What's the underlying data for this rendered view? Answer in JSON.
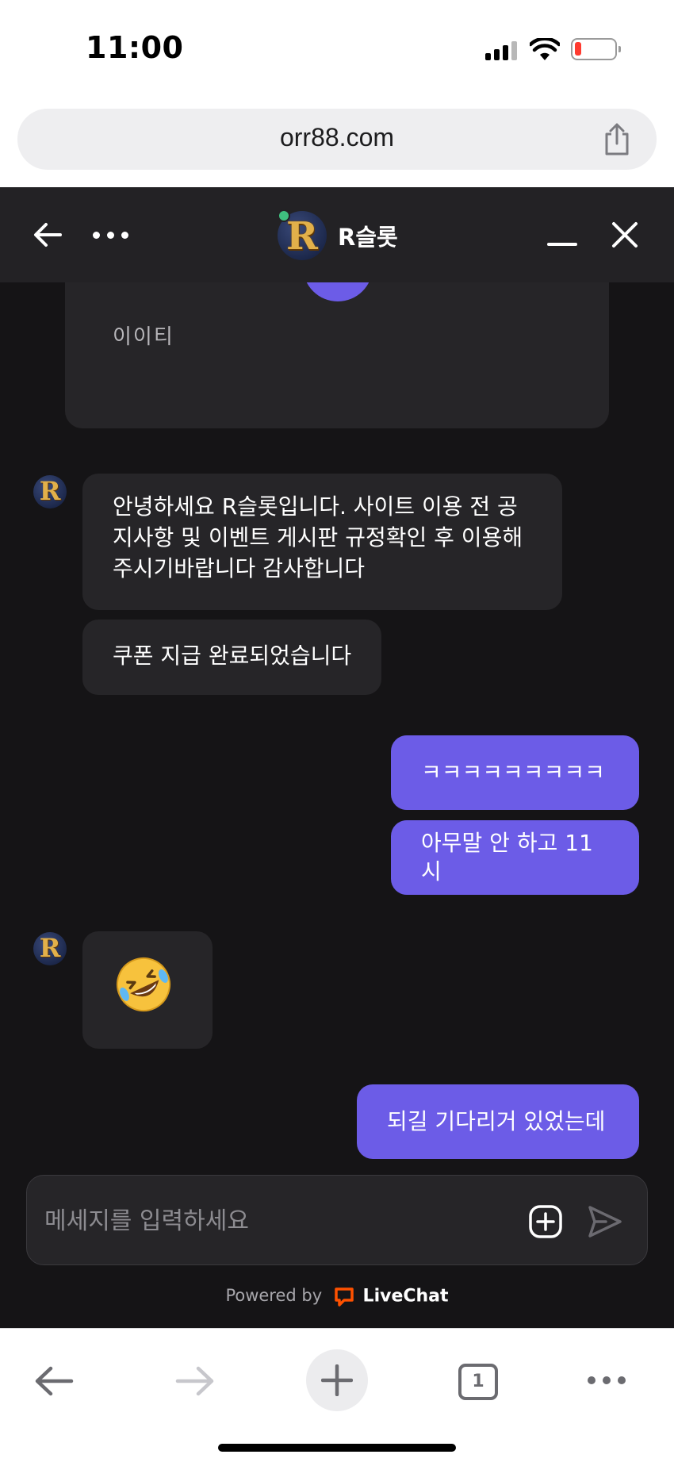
{
  "status_bar": {
    "time": "11:00"
  },
  "browser": {
    "url": "orr88.com",
    "tab_count": "1"
  },
  "chat": {
    "title": "R슬롯",
    "avatar_letter": "R",
    "card_text": "이이티",
    "messages": [
      {
        "from": "agent",
        "text": "안녕하세요 R슬롯입니다. 사이트 이용 전 공지사항 및 이벤트 게시판 규정확인 후 이용해주시기바랍니다 감사합니다"
      },
      {
        "from": "agent",
        "text": "쿠폰 지급 완료되었습니다"
      },
      {
        "from": "user",
        "text": "ㅋㅋㅋㅋㅋㅋㅋㅋㅋ"
      },
      {
        "from": "user",
        "text": "아무말 안 하고 11시"
      },
      {
        "from": "agent",
        "emoji": "rolling-on-floor-laughing"
      },
      {
        "from": "user",
        "text": "되길 기다리거 있었는데"
      }
    ],
    "composer_placeholder": "메세지를 입력하세요",
    "powered_by": "Powered by",
    "brand": "LiveChat"
  },
  "colors": {
    "accent": "#6c5ce7",
    "chat_bg": "#151416",
    "header_bg": "#232225",
    "bubble_in": "#262528",
    "online": "#3fbf7f",
    "livechat_orange": "#ff5100"
  }
}
